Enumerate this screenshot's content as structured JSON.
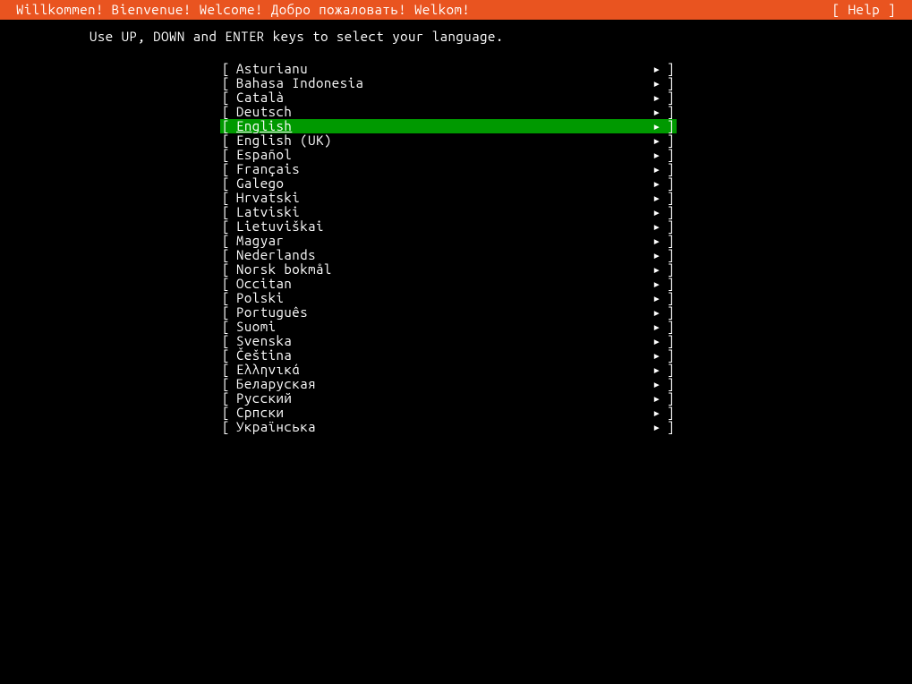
{
  "header": {
    "title": "Willkommen! Bienvenue! Welcome! Добро пожаловать! Welkom!",
    "help_label": "[ Help ]"
  },
  "instruction": "Use UP, DOWN and ENTER keys to select your language.",
  "glyphs": {
    "left_bracket": "[",
    "right_bracket": "]",
    "arrow": "▸"
  },
  "selected_index": 4,
  "languages": [
    {
      "label": "Asturianu"
    },
    {
      "label": "Bahasa Indonesia"
    },
    {
      "label": "Català"
    },
    {
      "label": "Deutsch"
    },
    {
      "label": "English"
    },
    {
      "label": "English (UK)"
    },
    {
      "label": "Español"
    },
    {
      "label": "Français"
    },
    {
      "label": "Galego"
    },
    {
      "label": "Hrvatski"
    },
    {
      "label": "Latviski"
    },
    {
      "label": "Lietuviškai"
    },
    {
      "label": "Magyar"
    },
    {
      "label": "Nederlands"
    },
    {
      "label": "Norsk bokmål"
    },
    {
      "label": "Occitan"
    },
    {
      "label": "Polski"
    },
    {
      "label": "Português"
    },
    {
      "label": "Suomi"
    },
    {
      "label": "Svenska"
    },
    {
      "label": "Čeština"
    },
    {
      "label": "Ελληνικά"
    },
    {
      "label": "Беларуская"
    },
    {
      "label": "Русский"
    },
    {
      "label": "Српски"
    },
    {
      "label": "Українська"
    }
  ]
}
